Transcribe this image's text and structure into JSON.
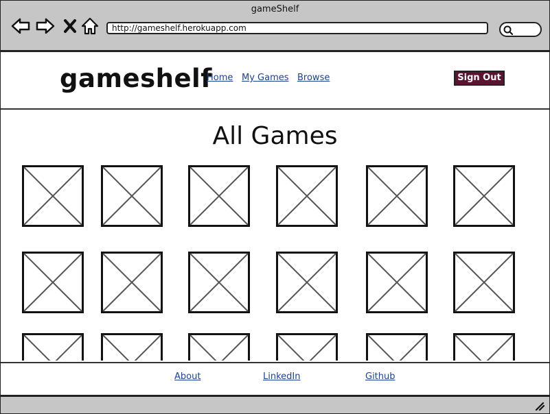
{
  "window": {
    "title": "gameShelf"
  },
  "browser": {
    "url": "http://gameshelf.herokuapp.com",
    "icons": [
      "back-arrow-icon",
      "forward-arrow-icon",
      "stop-x-icon",
      "home-icon",
      "search-icon"
    ]
  },
  "header": {
    "brand": "gameshelf",
    "nav": [
      {
        "label": "Home"
      },
      {
        "label": "My Games"
      },
      {
        "label": "Browse"
      }
    ],
    "sign_out_label": "Sign Out",
    "accent_color": "#5a1330"
  },
  "main": {
    "title": "All Games",
    "tile_rows": 3,
    "tile_cols": 6
  },
  "footer": {
    "links": [
      {
        "label": "About"
      },
      {
        "label": "LinkedIn"
      },
      {
        "label": "Github"
      }
    ]
  }
}
